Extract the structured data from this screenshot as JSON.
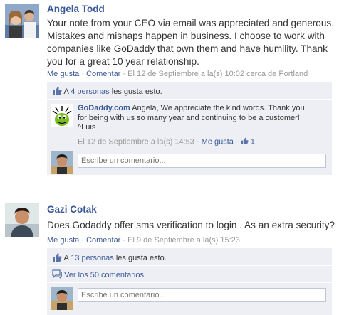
{
  "posts": [
    {
      "author": "Angela Todd",
      "message": "Your note from your CEO via email was appreciated and generous. Mistakes and mishaps happen in business. I choose to work with companies like GoDaddy that own them and have humility. Thank you for a great 10 year relationship.",
      "like_label": "Me gusta",
      "comment_label": "Comentar",
      "timestamp": "El 12 de Septiembre a la(s) 10:02 cerca de Portland",
      "likes_prefix": "A",
      "likes_link": "4 personas",
      "likes_suffix": "les gusta esto.",
      "reply": {
        "author": "GoDaddy.com",
        "text": "Angela, We appreciate the kind words. Thank you for being with us so many year and continuing to be a customer! ^Luis",
        "timestamp": "El 12 de Septiembre a la(s) 14:53",
        "like_label": "Me gusta",
        "like_count": "1"
      },
      "comment_placeholder": "Escribe un comentario..."
    },
    {
      "author": "Gazi Cotak",
      "message": "Does Godaddy offer sms verification to login . As an extra security?",
      "like_label": "Me gusta",
      "comment_label": "Comentar",
      "timestamp": "El 9 de Septiembre a la(s) 15:23",
      "likes_prefix": "A",
      "likes_link": "13 personas",
      "likes_suffix": "les gusta esto.",
      "view_comments": "Ver los 50 comentarios",
      "comment_placeholder": "Escribe un comentario..."
    }
  ],
  "separator": "·",
  "colors": {
    "link": "#3b5998",
    "ufi_bg": "#edeff4",
    "meta": "#999999"
  },
  "icons": [
    "thumbs-up-icon",
    "comments-icon",
    "godaddy-logo-icon"
  ]
}
